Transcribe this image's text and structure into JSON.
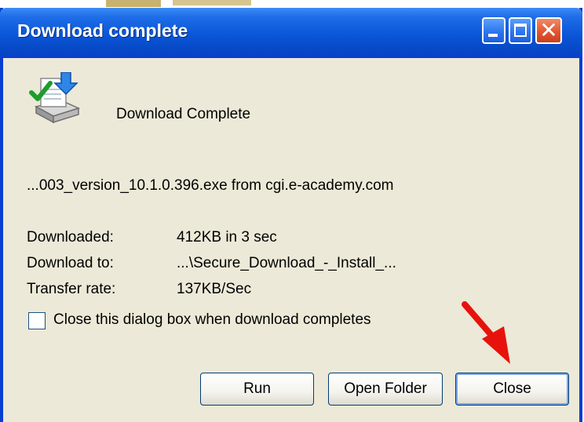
{
  "window": {
    "title": "Download complete",
    "controls": {
      "minimize": "minimize",
      "maximize": "maximize",
      "close": "close"
    },
    "accent_color": "#0a55d8",
    "close_color": "#e4562f"
  },
  "content": {
    "icon": "download-complete-icon",
    "header": "Download Complete",
    "file_line": "...003_version_10.1.0.396.exe from cgi.e-academy.com",
    "rows": [
      {
        "label": "Downloaded:",
        "value": "412KB in 3 sec"
      },
      {
        "label": "Download to:",
        "value": "...\\Secure_Download_-_Install_..."
      },
      {
        "label": "Transfer rate:",
        "value": "137KB/Sec"
      }
    ],
    "checkbox": {
      "label": "Close this dialog box when download completes",
      "checked": false
    }
  },
  "buttons": {
    "run": "Run",
    "open_folder": "Open Folder",
    "close": "Close"
  },
  "annotation": {
    "arrow_color": "#e8120c",
    "points_to": "close-button"
  }
}
